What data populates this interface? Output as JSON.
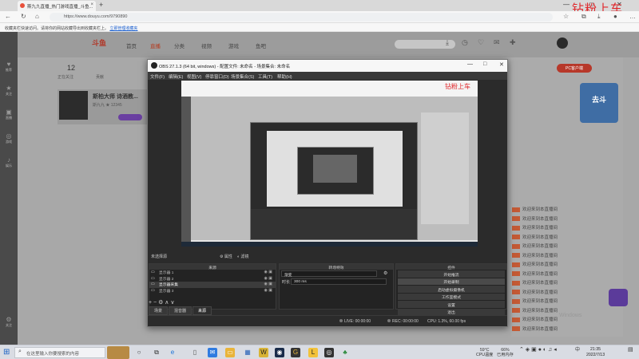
{
  "browser": {
    "tab_title": "斯九九直播_热门游戏直播_斗鱼...",
    "tab_close": "×",
    "new_tab": "+",
    "url": "https://www.douyu.com/9790890",
    "favorites_text": "收藏夹栏快速访问。请将你的网站收藏导出到收藏夹栏上。",
    "favorites_link": "立即管理收藏夹",
    "win_min": "—",
    "win_max": "□",
    "win_close": "✕",
    "watermark": "钻粉上车"
  },
  "site": {
    "logo": "斗鱼",
    "nav": [
      "首页",
      "直播",
      "分类",
      "视频",
      "游戏",
      "鱼吧"
    ],
    "header_labels": [
      "下载",
      "历史",
      "关注",
      "消息",
      "创作"
    ],
    "stats": {
      "count": "12",
      "label1": "正在关注",
      "label2": "贡献"
    },
    "room_title": "斯柏大师 诗酒教...",
    "room_sub": "斯九九  ★ 12345",
    "pc_button": "PC客户端",
    "promo": "去斗",
    "chat_lines": [
      "欢迎来到本直播间",
      "欢迎来到本直播间",
      "欢迎来到本直播间",
      "欢迎来到本直播间",
      "欢迎来到本直播间",
      "欢迎来到本直播间",
      "欢迎来到本直播间",
      "欢迎来到本直播间",
      "欢迎来到本直播间",
      "欢迎来到本直播间",
      "欢迎来到本直播间",
      "欢迎来到本直播间",
      "欢迎来到本直播间",
      "欢迎来到本直播间"
    ],
    "side_items": [
      "推荐",
      "关注",
      "直播",
      "游戏",
      "娱乐",
      "关注"
    ],
    "win_watermark": "Windows"
  },
  "obs": {
    "title": "OBS 27.1.3 (64 bit, windows) - 配置文件: 未命名 - 场景集合: 未命名",
    "menu": [
      "文件(F)",
      "编辑(E)",
      "视图(V)",
      "停靠窗口(D)",
      "场景集合(S)",
      "工具(T)",
      "帮助(H)"
    ],
    "no_source": "未选择源",
    "props_btn": "属性",
    "filters_btn": "滤镜",
    "docks": {
      "sources_head": "来源",
      "sources": [
        {
          "name": "显示器 1",
          "selected": false
        },
        {
          "name": "显示器 2",
          "selected": false
        },
        {
          "name": "显示器采集",
          "selected": true
        },
        {
          "name": "显示器 3",
          "selected": false
        }
      ],
      "tools": "+ − ⚙ ∧ ∨",
      "tabs": [
        "场景",
        "混音器",
        "来源"
      ],
      "transition_head": "转场特效",
      "transition_type": "渐变",
      "duration_label": "时长",
      "duration_value": "300 ms",
      "controls_head": "控件",
      "controls": [
        "开始推流",
        "开始录制",
        "启动虚拟摄像机",
        "工作室模式",
        "设置",
        "退出"
      ]
    },
    "status": {
      "live": "LIVE: 00:00:00",
      "rec": "REC: 00:00:00",
      "cpu": "CPU: 1.3%, 60.00 fps"
    }
  },
  "taskbar": {
    "search_placeholder": "在这里输入你要搜索的内容",
    "weather": "59°C",
    "weather_sub": "CPU温度",
    "util": "66%",
    "util_sub": "已用内存",
    "time": "21:35",
    "date": "2022/7/13",
    "lang": "中"
  }
}
